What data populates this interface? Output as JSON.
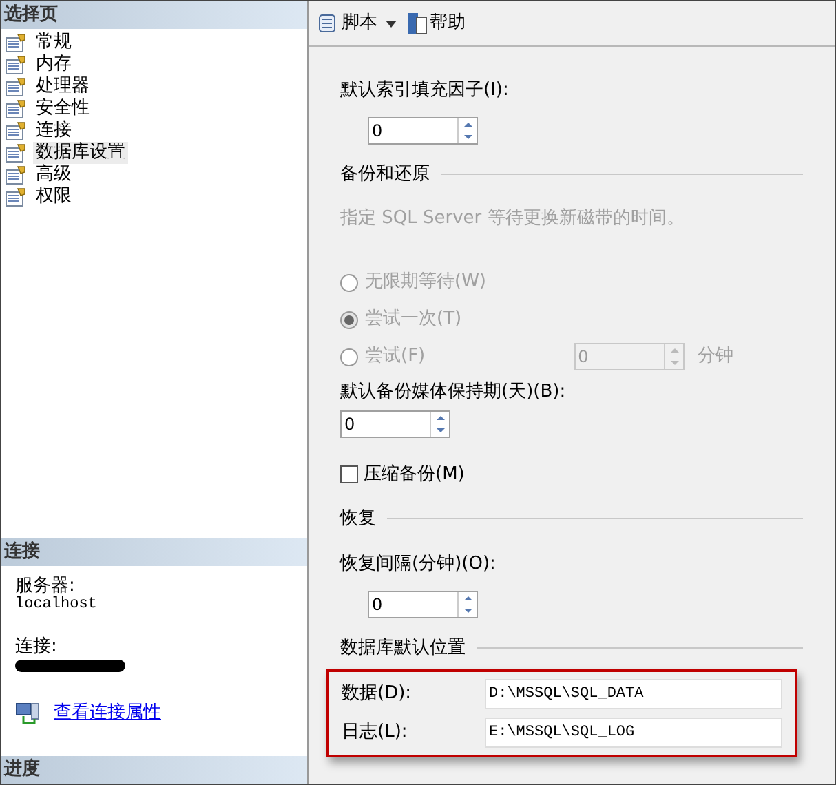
{
  "sidebar": {
    "title": "选择页",
    "items": [
      {
        "label": "常规",
        "selected": false
      },
      {
        "label": "内存",
        "selected": false
      },
      {
        "label": "处理器",
        "selected": false
      },
      {
        "label": "安全性",
        "selected": false
      },
      {
        "label": "连接",
        "selected": false
      },
      {
        "label": "数据库设置",
        "selected": true
      },
      {
        "label": "高级",
        "selected": false
      },
      {
        "label": "权限",
        "selected": false
      }
    ]
  },
  "connection": {
    "title": "连接",
    "server_label": "服务器:",
    "server": "localhost",
    "connection_label": "连接:",
    "connection_redacted": true,
    "link": "查看连接属性"
  },
  "progress": {
    "title": "进度"
  },
  "toolbar": {
    "script": "脚本",
    "help": "帮助"
  },
  "fill_factor": {
    "label": "默认索引填充因子(I):",
    "value": "0",
    "disabled": false
  },
  "backup": {
    "title": "备份和还原",
    "hint": "指定 SQL Server 等待更换新磁带的时间。",
    "options": [
      {
        "label": "无限期等待(W)",
        "selected": false,
        "disabled": true
      },
      {
        "label": "尝试一次(T)",
        "selected": true,
        "disabled": true
      },
      {
        "label": "尝试(F)",
        "selected": false,
        "disabled": true
      }
    ],
    "minutes": {
      "value": "0",
      "disabled": true,
      "unit": "分钟"
    },
    "retention_label": "默认备份媒体保持期(天)(B):",
    "retention": {
      "value": "0",
      "disabled": false
    },
    "compress": {
      "label": "压缩备份(M)",
      "checked": false
    }
  },
  "recovery": {
    "title": "恢复",
    "interval_label": "恢复间隔(分钟)(O):",
    "interval": {
      "value": "0",
      "disabled": false
    }
  },
  "locations": {
    "title": "数据库默认位置",
    "highlighted": true,
    "paths": [
      {
        "label": "数据(D):",
        "value": "D:\\MSSQL\\SQL_DATA"
      },
      {
        "label": "日志(L):",
        "value": "E:\\MSSQL\\SQL_LOG"
      }
    ]
  }
}
